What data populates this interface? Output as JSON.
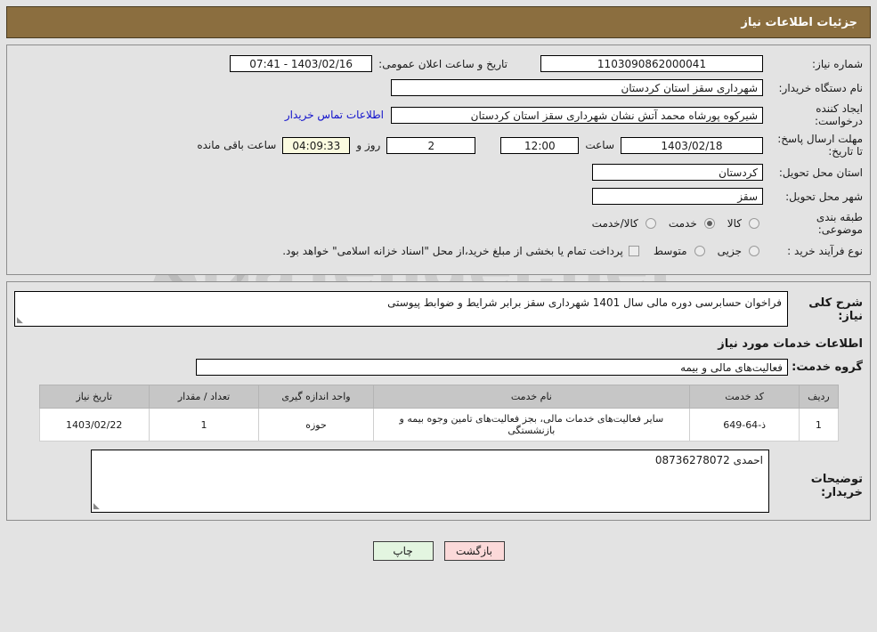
{
  "header": {
    "title": "جزئیات اطلاعات نیاز"
  },
  "form": {
    "need_number_label": "شماره نیاز:",
    "need_number_value": "1103090862000041",
    "announce_datetime_label": "تاریخ و ساعت اعلان عمومی:",
    "announce_datetime_value": "1403/02/16 - 07:41",
    "buyer_org_label": "نام دستگاه خریدار:",
    "buyer_org_value": "شهرداری سقز استان کردستان",
    "creator_label": "ایجاد کننده درخواست:",
    "creator_value": "شیرکوه پورشاه محمد آتش نشان شهرداری سقز استان کردستان",
    "contact_link": "اطلاعات تماس خریدار",
    "deadline_label": "مهلت ارسال پاسخ: تا تاریخ:",
    "deadline_date": "1403/02/18",
    "hour_label": "ساعت",
    "hour_value": "12:00",
    "days_remaining": "2",
    "days_label": "روز و",
    "countdown": "04:09:33",
    "countdown_suffix": "ساعت باقی مانده",
    "delivery_province_label": "استان محل تحویل:",
    "delivery_province_value": "کردستان",
    "delivery_city_label": "شهر محل تحویل:",
    "delivery_city_value": "سقز",
    "category_label": "طبقه بندی موضوعی:",
    "category_options": [
      {
        "label": "کالا",
        "selected": false
      },
      {
        "label": "خدمت",
        "selected": true
      },
      {
        "label": "کالا/خدمت",
        "selected": false
      }
    ],
    "process_type_label": "نوع فرآیند خرید :",
    "process_options": [
      {
        "label": "جزیی",
        "selected": false
      },
      {
        "label": "متوسط",
        "selected": false
      }
    ],
    "treasury_note": "پرداخت تمام یا بخشی از مبلغ خرید،از محل \"اسناد خزانه اسلامی\" خواهد بود."
  },
  "description": {
    "label": "شرح کلی نیاز:",
    "value": "فراخوان حسابرسی دوره مالی سال 1401 شهرداری سقز برابر شرایط و ضوابط پیوستی"
  },
  "services": {
    "section_title": "اطلاعات خدمات مورد نیاز",
    "group_label": "گروه خدمت:",
    "group_value": "فعالیت‌های مالی و بیمه",
    "table": {
      "columns": [
        "ردیف",
        "کد خدمت",
        "نام خدمت",
        "واحد اندازه گیری",
        "تعداد / مقدار",
        "تاریخ نیاز"
      ],
      "rows": [
        {
          "radif": "1",
          "code": "ذ-64-649",
          "name": "سایر فعالیت‌های خدمات مالی، بجز فعالیت‌های تامین وجوه بیمه و بازنشستگی",
          "unit": "حوزه",
          "quantity": "1",
          "need_date": "1403/02/22"
        }
      ]
    }
  },
  "buyer_notes": {
    "label": "توضیحات خریدار:",
    "value": "احمدی 08736278072"
  },
  "footer": {
    "print_button": "چاپ",
    "return_button": "بازگشت"
  },
  "watermark": {
    "text": "AriaTender.net"
  },
  "colors": {
    "header_bg": "#8b6e3f",
    "timer_bg": "#fbfbe0",
    "link": "#1111cc",
    "print_btn_bg": "#e3f5e0",
    "return_btn_bg": "#fbd9d9"
  }
}
